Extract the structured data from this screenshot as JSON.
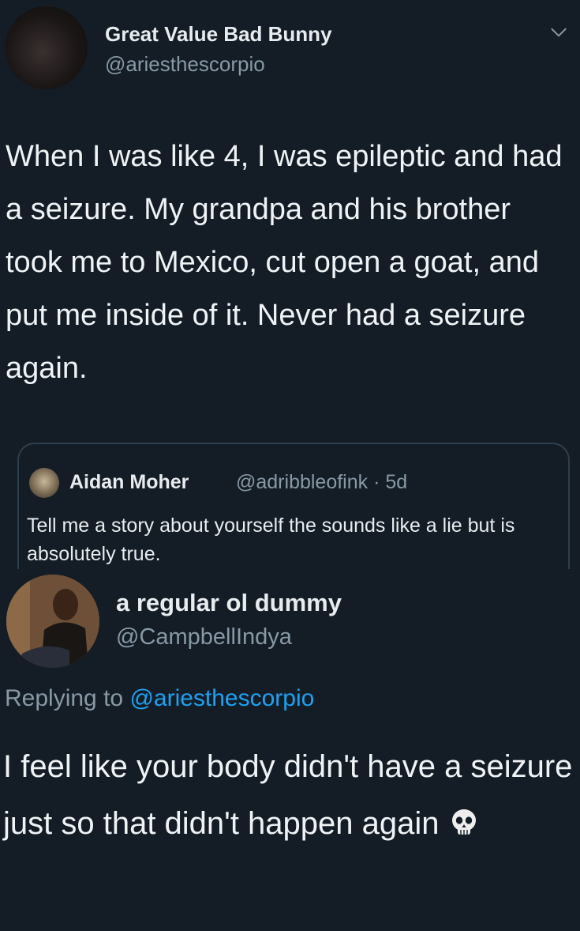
{
  "tweet": {
    "author_name": "Great Value Bad Bunny",
    "author_handle": "@ariesthescorpio",
    "text": "When I was like 4, I was epileptic and had a seizure. My grandpa and his brother took me to Mexico, cut open a goat, and put me inside of it. Never had a seizure again."
  },
  "quoted_tweet": {
    "author_name": "Aidan Moher",
    "meta": "@adribbleofink · 5d",
    "text": "Tell me a story about yourself the sounds like a lie but is absolutely true."
  },
  "reply": {
    "author_name": "a regular ol dummy",
    "author_handle": "@CampbellIndya",
    "replying_label": "Replying to",
    "replying_handle": "@ariesthescorpio",
    "text": "I feel like your body didn't have a seizure just so that didn't happen again",
    "emoji_icon": "skull-icon"
  },
  "colors": {
    "background": "#141d26",
    "secondary_text": "#8899a6",
    "link": "#1da1f2"
  }
}
